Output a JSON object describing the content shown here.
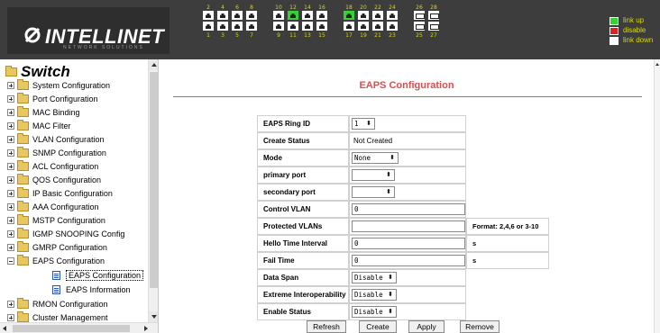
{
  "header": {
    "logo_text": "INTELLINET",
    "logo_subtitle": "NETWORK SOLUTIONS",
    "ports_top_numbers": [
      "2",
      "4",
      "6",
      "8",
      "10",
      "12",
      "14",
      "16",
      "18",
      "20",
      "22",
      "24",
      "26",
      "28"
    ],
    "ports_bottom_numbers": [
      "1",
      "3",
      "5",
      "7",
      "9",
      "11",
      "13",
      "15",
      "17",
      "19",
      "21",
      "23",
      "25",
      "27"
    ],
    "legend": [
      {
        "label": "link up",
        "color": "#38d038"
      },
      {
        "label": "disable",
        "color": "#e02020"
      },
      {
        "label": "link down",
        "color": "#ffffff"
      }
    ]
  },
  "sidebar": {
    "title": "Switch",
    "items": [
      {
        "label": "System Configuration"
      },
      {
        "label": "Port Configuration"
      },
      {
        "label": "MAC Binding"
      },
      {
        "label": "MAC Filter"
      },
      {
        "label": "VLAN Configuration"
      },
      {
        "label": "SNMP Configuration"
      },
      {
        "label": "ACL Configuration"
      },
      {
        "label": "QOS Configuration"
      },
      {
        "label": "IP Basic Configuration"
      },
      {
        "label": "AAA Configuration"
      },
      {
        "label": "MSTP Configuration"
      },
      {
        "label": "IGMP SNOOPING Config"
      },
      {
        "label": "GMRP Configuration"
      },
      {
        "label": "EAPS Configuration"
      },
      {
        "label": "RMON Configuration"
      },
      {
        "label": "Cluster Management"
      }
    ],
    "eaps_children": [
      {
        "label": "EAPS Configuration",
        "selected": true
      },
      {
        "label": "EAPS Information"
      }
    ]
  },
  "main": {
    "title": "EAPS Configuration",
    "title_color": "#d85050",
    "fields": {
      "ring_id": {
        "label": "EAPS Ring ID",
        "value": "1"
      },
      "create_status": {
        "label": "Create Status",
        "value": "Not Created"
      },
      "mode": {
        "label": "Mode",
        "value": "None"
      },
      "primary_port": {
        "label": "primary port",
        "value": ""
      },
      "secondary_port": {
        "label": "secondary port",
        "value": ""
      },
      "control_vlan": {
        "label": "Control VLAN",
        "value": "0"
      },
      "protected_vlans": {
        "label": "Protected VLANs",
        "value": "",
        "note": "Format: 2,4,6 or 3-10"
      },
      "hello_time": {
        "label": "Hello Time Interval",
        "value": "0",
        "unit": "s"
      },
      "fail_time": {
        "label": "Fail Time",
        "value": "0",
        "unit": "s"
      },
      "data_span": {
        "label": "Data Span",
        "value": "Disable"
      },
      "extreme_interop": {
        "label": "Extreme Interoperability",
        "value": "Disable"
      },
      "enable_status": {
        "label": "Enable Status",
        "value": "Disable"
      }
    },
    "buttons": {
      "refresh": "Refresh",
      "create": "Create",
      "apply": "Apply",
      "remove": "Remove"
    }
  }
}
